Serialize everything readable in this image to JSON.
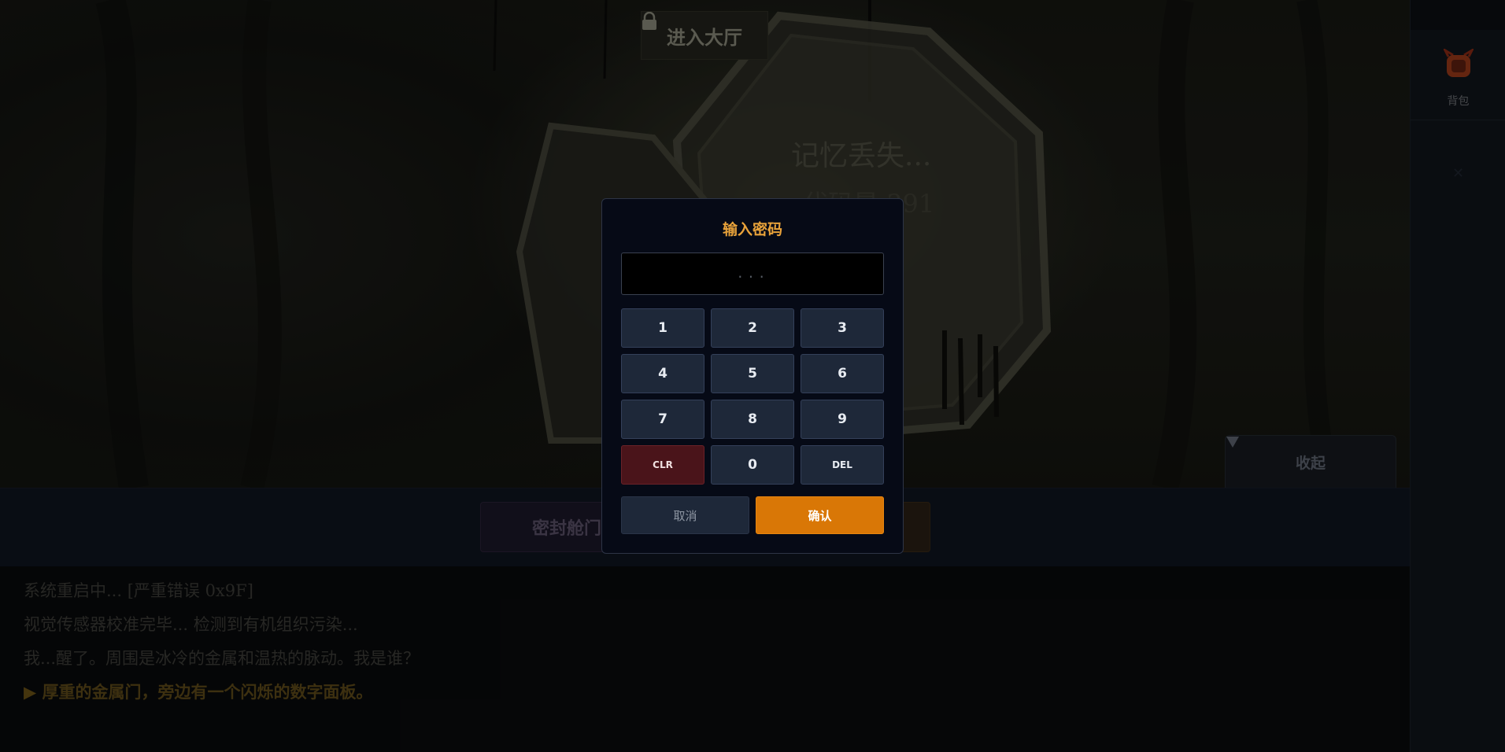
{
  "hall_button": {
    "label": "进入大厅",
    "icon": "lock-icon"
  },
  "scene": {
    "wall_text_line1": "记忆丢失...",
    "wall_text_line2": "代码是 391"
  },
  "collapse_button": {
    "label": "收起",
    "icon": "triangle-down-icon"
  },
  "sidebar": {
    "bag_label": "背包",
    "bag_icon": "backpack-icon",
    "close_icon": "close-icon"
  },
  "choices": [
    {
      "label": "密封舱门"
    },
    {
      "label": ""
    }
  ],
  "story": {
    "lines": [
      "系统重启中... [严重错误 0x9F]",
      "视觉传感器校准完毕... 检测到有机组织污染...",
      "我...醒了。周围是冰冷的金属和温热的脉动。我是谁？"
    ],
    "highlight": "厚重的金属门，旁边有一个闪烁的数字面板。",
    "highlight_marker": "▶"
  },
  "modal": {
    "title": "输入密码",
    "input_placeholder": "...",
    "keys": [
      "1",
      "2",
      "3",
      "4",
      "5",
      "6",
      "7",
      "8",
      "9",
      "CLR",
      "0",
      "DEL"
    ],
    "cancel_label": "取消",
    "confirm_label": "确认"
  },
  "colors": {
    "accent": "#e8a23a",
    "confirm": "#d97706",
    "danger": "#4a141a",
    "modal_bg": "#060a16"
  }
}
